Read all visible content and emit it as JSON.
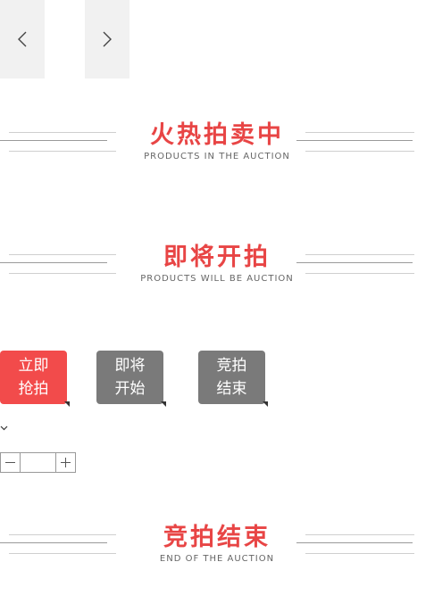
{
  "carousel": {
    "prev_icon": "chevron-left-icon",
    "next_icon": "chevron-right-icon"
  },
  "sections": {
    "hot": {
      "title": "火热拍卖中",
      "subtitle": "PRODUCTS IN THE AUCTION"
    },
    "upcoming": {
      "title": "即将开拍",
      "subtitle": "PRODUCTS WILL BE AUCTION"
    },
    "ended": {
      "title": "竞拍结束",
      "subtitle": "END OF THE AUCTION"
    }
  },
  "tags": {
    "bid_now": {
      "line1": "立即",
      "line2": "抢拍",
      "color": "#f24b4b"
    },
    "coming_soon": {
      "line1": "即将",
      "line2": "开始",
      "color": "#7a7a7a"
    },
    "ended": {
      "line1": "竞拍",
      "line2": "结束",
      "color": "#7a7a7a"
    }
  },
  "dropdown_icon": "chevron-down-icon",
  "quantity": {
    "value": "",
    "minus_icon": "minus-icon",
    "plus_icon": "plus-icon"
  },
  "colors": {
    "accent": "#e84545",
    "muted": "#7a7a7a"
  }
}
